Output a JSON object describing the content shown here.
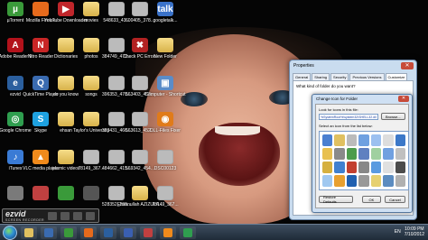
{
  "desktop": {
    "icons": [
      {
        "label": "µTorrent",
        "color": "#3a9a3a",
        "sym": "µ",
        "kind": "app"
      },
      {
        "label": "Mozilla Firefox",
        "color": "#e66a1c",
        "sym": "",
        "kind": "app"
      },
      {
        "label": "YouTube Downloader",
        "color": "#c0262b",
        "sym": "▶",
        "kind": "app"
      },
      {
        "label": "movies",
        "color": "",
        "sym": "",
        "kind": "folder"
      },
      {
        "label": "548633_43...",
        "color": "#bbb",
        "sym": "",
        "kind": "doc"
      },
      {
        "label": "600405_378...",
        "color": "#bbb",
        "sym": "",
        "kind": "doc"
      },
      {
        "label": "googletalk...",
        "color": "#3a72c9",
        "sym": "talk",
        "kind": "app"
      },
      {
        "label": "Adobe Reader 9",
        "color": "#b3121b",
        "sym": "A",
        "kind": "app"
      },
      {
        "label": "Nitro Reader",
        "color": "#c82626",
        "sym": "N",
        "kind": "app"
      },
      {
        "label": "Dictionaries",
        "color": "",
        "sym": "",
        "kind": "folder"
      },
      {
        "label": "photos",
        "color": "",
        "sym": "",
        "kind": "folder"
      },
      {
        "label": "384749_470...",
        "color": "#bbb",
        "sym": "",
        "kind": "doc"
      },
      {
        "label": "Check PC Errors",
        "color": "#b22222",
        "sym": "✖",
        "kind": "app"
      },
      {
        "label": "New Folder",
        "color": "",
        "sym": "",
        "kind": "folder"
      },
      {
        "label": "ezvid",
        "color": "#2b5f9e",
        "sym": "e",
        "kind": "app"
      },
      {
        "label": "QuickTime Player",
        "color": "#3a6bb0",
        "sym": "Q",
        "kind": "app"
      },
      {
        "label": "do you know",
        "color": "",
        "sym": "",
        "kind": "folder"
      },
      {
        "label": "songs",
        "color": "",
        "sym": "",
        "kind": "folder"
      },
      {
        "label": "396353_470...",
        "color": "#bbb",
        "sym": "",
        "kind": "doc"
      },
      {
        "label": "563403_452...",
        "color": "#bbb",
        "sym": "",
        "kind": "doc"
      },
      {
        "label": "Computer - Shortcut",
        "color": "#5a8cc8",
        "sym": "▣",
        "kind": "app"
      },
      {
        "label": "Google Chrome",
        "color": "#2f9e4f",
        "sym": "◎",
        "kind": "app"
      },
      {
        "label": "Skype",
        "color": "#1ea1e0",
        "sym": "S",
        "kind": "app"
      },
      {
        "label": "ehsan",
        "color": "",
        "sym": "",
        "kind": "folder"
      },
      {
        "label": "Taylor's University",
        "color": "",
        "sym": "",
        "kind": "folder"
      },
      {
        "label": "393431_466...",
        "color": "#bbb",
        "sym": "",
        "kind": "doc"
      },
      {
        "label": "563613_452...",
        "color": "#bbb",
        "sym": "",
        "kind": "doc"
      },
      {
        "label": "DLL-Files Fixer",
        "color": "#e07b1a",
        "sym": "◉",
        "kind": "app"
      },
      {
        "label": "iTunes",
        "color": "#3a7bd5",
        "sym": "♪",
        "kind": "app"
      },
      {
        "label": "VLC media player",
        "color": "#f08a1c",
        "sym": "▲",
        "kind": "app"
      },
      {
        "label": "islamic videos",
        "color": "",
        "sym": "",
        "kind": "folder"
      },
      {
        "label": "78149_367...",
        "color": "#bbb",
        "sym": "",
        "kind": "doc"
      },
      {
        "label": "484662_415...",
        "color": "#bbb",
        "sym": "",
        "kind": "doc"
      },
      {
        "label": "569342_454...",
        "color": "#bbb",
        "sym": "",
        "kind": "doc"
      },
      {
        "label": "DSC00123",
        "color": "#bbb",
        "sym": "",
        "kind": "doc"
      },
      {
        "label": "",
        "color": "#7a7a7a",
        "sym": "",
        "kind": "app"
      },
      {
        "label": "",
        "color": "#c04040",
        "sym": "",
        "kind": "app"
      },
      {
        "label": "",
        "color": "#3a9a3a",
        "sym": "",
        "kind": "app"
      },
      {
        "label": "",
        "color": "#555",
        "sym": "",
        "kind": "app"
      },
      {
        "label": "528352_398...",
        "color": "#bbb",
        "sym": "",
        "kind": "doc"
      },
      {
        "label": "Ehsanullah AZIZULA...",
        "color": "",
        "sym": "",
        "kind": "folder"
      },
      {
        "label": "78149_367...",
        "color": "#bbb",
        "sym": "",
        "kind": "doc"
      }
    ]
  },
  "properties_window": {
    "title": "Properties",
    "tabs": [
      "General",
      "Sharing",
      "Security",
      "Previous Versions",
      "Customize"
    ],
    "question": "What kind of folder do you want?"
  },
  "change_icon_dialog": {
    "title": "Change Icon for  Folder",
    "path_label": "Look for icons in this file:",
    "path_value": "%SystemRoot%\\system32\\SHELL32.dll",
    "browse_label": "Browse...",
    "select_label": "Select an icon from the list below:",
    "restore_label": "Restore Defaults",
    "ok_label": "OK",
    "cancel_label": "Cancel",
    "icon_colors": [
      "#4a7fd0",
      "#e0c060",
      "#bbb",
      "#6fa0e0",
      "#9cc0f0",
      "#ddd",
      "#3c78c8",
      "#e8c050",
      "#8a8a8a",
      "#4c9c4c",
      "#6080c0",
      "#a0d0a0",
      "#70a0e0",
      "#c0c0c0",
      "#d6b040",
      "#4080d0",
      "#c24030",
      "#888",
      "#5a9ae0",
      "#e0e0e0",
      "#4c4c4c",
      "#a0c8f0",
      "#e8a030",
      "#2060b0",
      "#999",
      "#e6d070",
      "#5c8cc0",
      "#b0b0b0"
    ]
  },
  "watermark": {
    "logo": "ezvid",
    "sub": "SCREEN RECORDER"
  },
  "taskbar": {
    "items": [
      {
        "name": "explorer",
        "color": "#e0c060"
      },
      {
        "name": "media-player",
        "color": "#3a6bb0"
      },
      {
        "name": "utorrent",
        "color": "#3a9a3a"
      },
      {
        "name": "firefox",
        "color": "#e66a1c"
      },
      {
        "name": "ezvid",
        "color": "#2b5f9e"
      },
      {
        "name": "word",
        "color": "#3a5fb0"
      },
      {
        "name": "paint",
        "color": "#c04040"
      },
      {
        "name": "vlc",
        "color": "#f08a1c"
      },
      {
        "name": "chrome",
        "color": "#2f9e4f"
      }
    ],
    "lang": "EN",
    "time": "10:09 PM",
    "date": "7/10/2012"
  }
}
